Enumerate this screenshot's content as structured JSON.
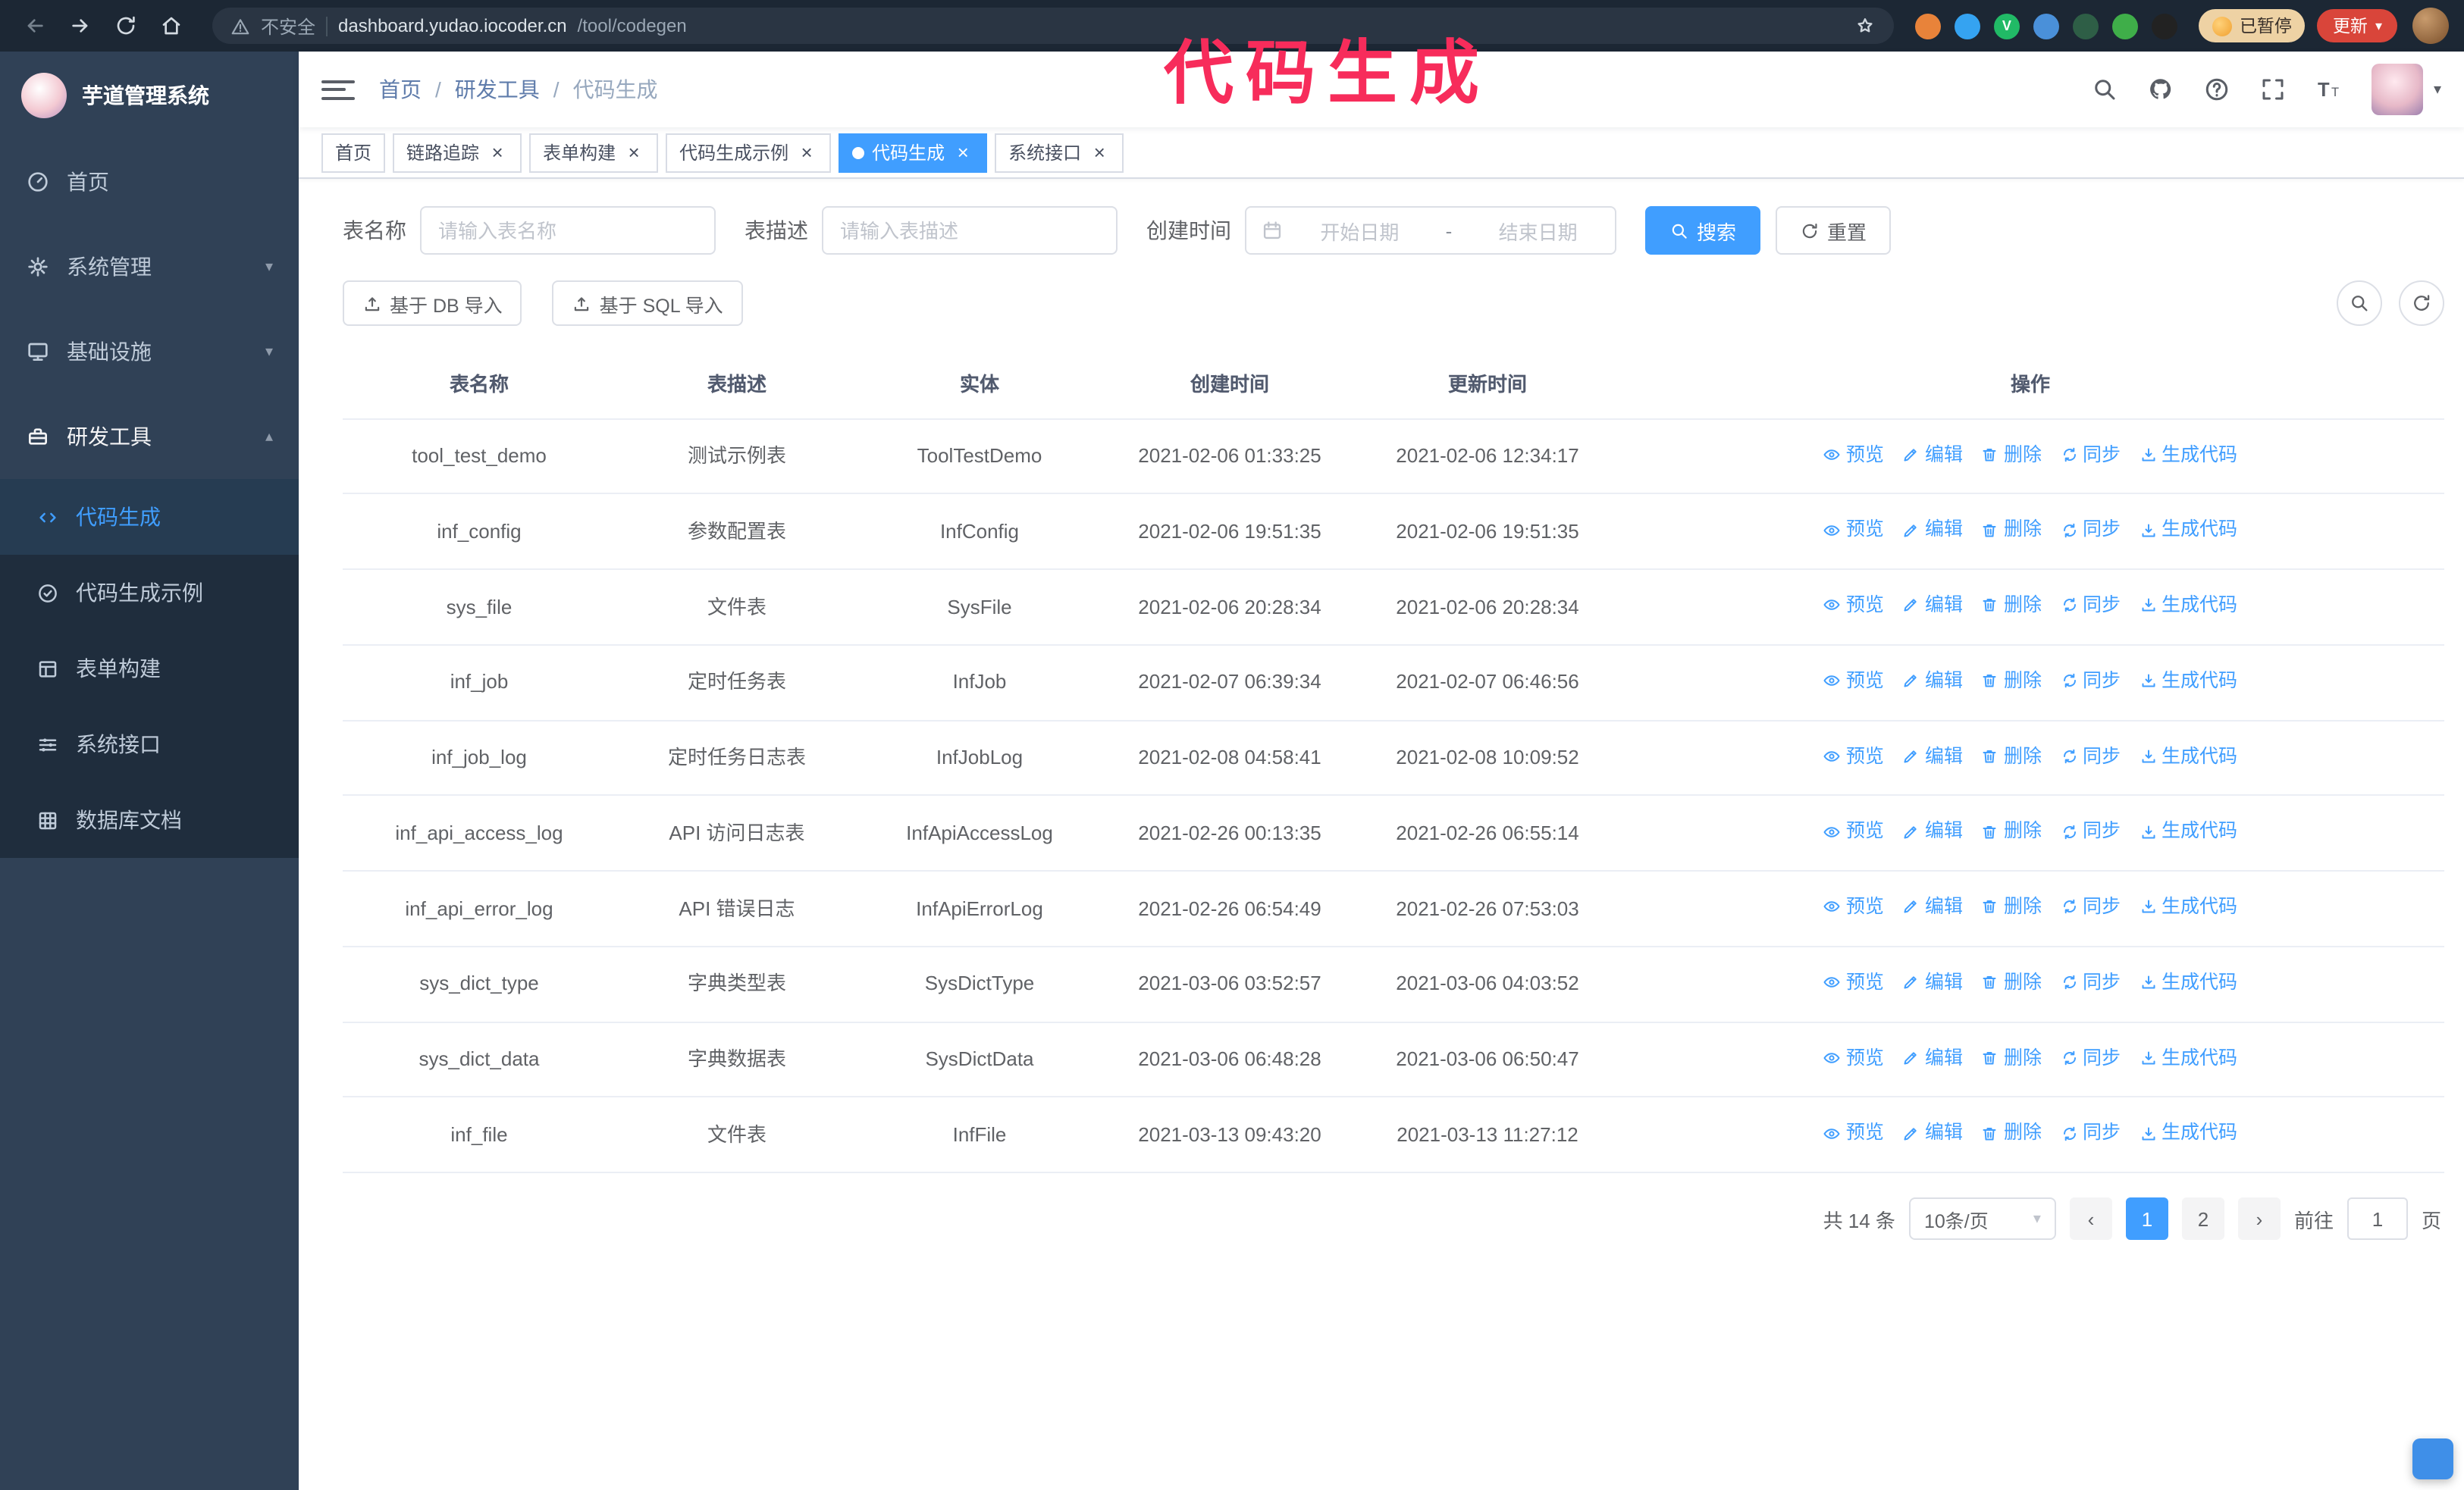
{
  "colors": {
    "accent": "#409eff",
    "annotation": "#f72c5b",
    "sidebar_bg": "#304156",
    "submenu_bg": "#1f2d3d",
    "update_button_bg": "#d9453a",
    "paused_badge_bg": "#eed2a4"
  },
  "annotation": {
    "text": "代码生成"
  },
  "icons": {
    "caret_down": "▾",
    "caret_up": "▴",
    "close": "×",
    "prev": "‹",
    "next": "›"
  },
  "browser": {
    "not_secure_label": "不安全",
    "url_host": "dashboard.yudao.iocoder.cn",
    "url_path": "/tool/codegen",
    "paused_badge": "已暂停",
    "update_button": "更新",
    "extensions": [
      {
        "name": "orange-extension-icon",
        "color": "#e8833a"
      },
      {
        "name": "drop-extension-icon",
        "color": "#35a3f1"
      },
      {
        "name": "v-extension-icon",
        "color": "#21ba66",
        "glyph": "V"
      },
      {
        "name": "people-extension-icon",
        "color": "#4a90d9"
      },
      {
        "name": "screen-extension-icon",
        "color": "#2e5e46"
      },
      {
        "name": "leaf-extension-icon",
        "color": "#3fae49"
      },
      {
        "name": "knot-extension-icon",
        "color": "#222222"
      }
    ]
  },
  "sidebar": {
    "logo_title": "芋道管理系统",
    "items": [
      {
        "key": "home",
        "label": "首页",
        "icon": "dashboard-icon",
        "expandable": false,
        "expanded": false
      },
      {
        "key": "system",
        "label": "系统管理",
        "icon": "gear-icon",
        "expandable": true,
        "expanded": false
      },
      {
        "key": "infra",
        "label": "基础设施",
        "icon": "infra-icon",
        "expandable": true,
        "expanded": false
      },
      {
        "key": "devtools",
        "label": "研发工具",
        "icon": "tools-icon",
        "expandable": true,
        "expanded": true
      }
    ],
    "subitems": [
      {
        "key": "codegen",
        "label": "代码生成",
        "icon": "code-icon",
        "active": true
      },
      {
        "key": "codegen-demo",
        "label": "代码生成示例",
        "icon": "example-icon",
        "active": false
      },
      {
        "key": "form-builder",
        "label": "表单构建",
        "icon": "form-icon",
        "active": false
      },
      {
        "key": "api",
        "label": "系统接口",
        "icon": "api-icon",
        "active": false
      },
      {
        "key": "db-doc",
        "label": "数据库文档",
        "icon": "db-icon",
        "active": false
      }
    ]
  },
  "header": {
    "breadcrumb": [
      "首页",
      "研发工具",
      "代码生成"
    ],
    "separator": "/"
  },
  "tabs": [
    {
      "key": "home",
      "label": "首页",
      "closable": false,
      "active": false
    },
    {
      "key": "tracing",
      "label": "链路追踪",
      "closable": true,
      "active": false
    },
    {
      "key": "form-builder",
      "label": "表单构建",
      "closable": true,
      "active": false
    },
    {
      "key": "codegen-demo",
      "label": "代码生成示例",
      "closable": true,
      "active": false
    },
    {
      "key": "codegen",
      "label": "代码生成",
      "closable": true,
      "active": true
    },
    {
      "key": "api",
      "label": "系统接口",
      "closable": true,
      "active": false
    }
  ],
  "filters": {
    "table_name_label": "表名称",
    "table_name_placeholder": "请输入表名称",
    "table_desc_label": "表描述",
    "table_desc_placeholder": "请输入表描述",
    "create_time_label": "创建时间",
    "date_start_placeholder": "开始日期",
    "date_separator": "-",
    "date_end_placeholder": "结束日期",
    "search_button": "搜索",
    "reset_button": "重置"
  },
  "toolbar": {
    "import_db": "基于 DB 导入",
    "import_sql": "基于 SQL 导入"
  },
  "table": {
    "columns": [
      "表名称",
      "表描述",
      "实体",
      "创建时间",
      "更新时间",
      "操作"
    ],
    "op_labels": [
      "预览",
      "编辑",
      "删除",
      "同步",
      "生成代码"
    ],
    "rows": [
      {
        "name": "tool_test_demo",
        "desc": "测试示例表",
        "entity": "ToolTestDemo",
        "created": "2021-02-06 01:33:25",
        "updated": "2021-02-06 12:34:17"
      },
      {
        "name": "inf_config",
        "desc": "参数配置表",
        "entity": "InfConfig",
        "created": "2021-02-06 19:51:35",
        "updated": "2021-02-06 19:51:35"
      },
      {
        "name": "sys_file",
        "desc": "文件表",
        "entity": "SysFile",
        "created": "2021-02-06 20:28:34",
        "updated": "2021-02-06 20:28:34"
      },
      {
        "name": "inf_job",
        "desc": "定时任务表",
        "entity": "InfJob",
        "created": "2021-02-07 06:39:34",
        "updated": "2021-02-07 06:46:56"
      },
      {
        "name": "inf_job_log",
        "desc": "定时任务日志表",
        "entity": "InfJobLog",
        "created": "2021-02-08 04:58:41",
        "updated": "2021-02-08 10:09:52"
      },
      {
        "name": "inf_api_access_log",
        "desc": "API 访问日志表",
        "entity": "InfApiAccessLog",
        "created": "2021-02-26 00:13:35",
        "updated": "2021-02-26 06:55:14"
      },
      {
        "name": "inf_api_error_log",
        "desc": "API 错误日志",
        "entity": "InfApiErrorLog",
        "created": "2021-02-26 06:54:49",
        "updated": "2021-02-26 07:53:03"
      },
      {
        "name": "sys_dict_type",
        "desc": "字典类型表",
        "entity": "SysDictType",
        "created": "2021-03-06 03:52:57",
        "updated": "2021-03-06 04:03:52"
      },
      {
        "name": "sys_dict_data",
        "desc": "字典数据表",
        "entity": "SysDictData",
        "created": "2021-03-06 06:48:28",
        "updated": "2021-03-06 06:50:47"
      },
      {
        "name": "inf_file",
        "desc": "文件表",
        "entity": "InfFile",
        "created": "2021-03-13 09:43:20",
        "updated": "2021-03-13 11:27:12"
      }
    ]
  },
  "pagination": {
    "total": "共 14 条",
    "page_size": "10条/页",
    "pages": [
      "1",
      "2"
    ],
    "active_page": "1",
    "goto_label": "前往",
    "goto_value": "1",
    "goto_suffix": "页"
  }
}
